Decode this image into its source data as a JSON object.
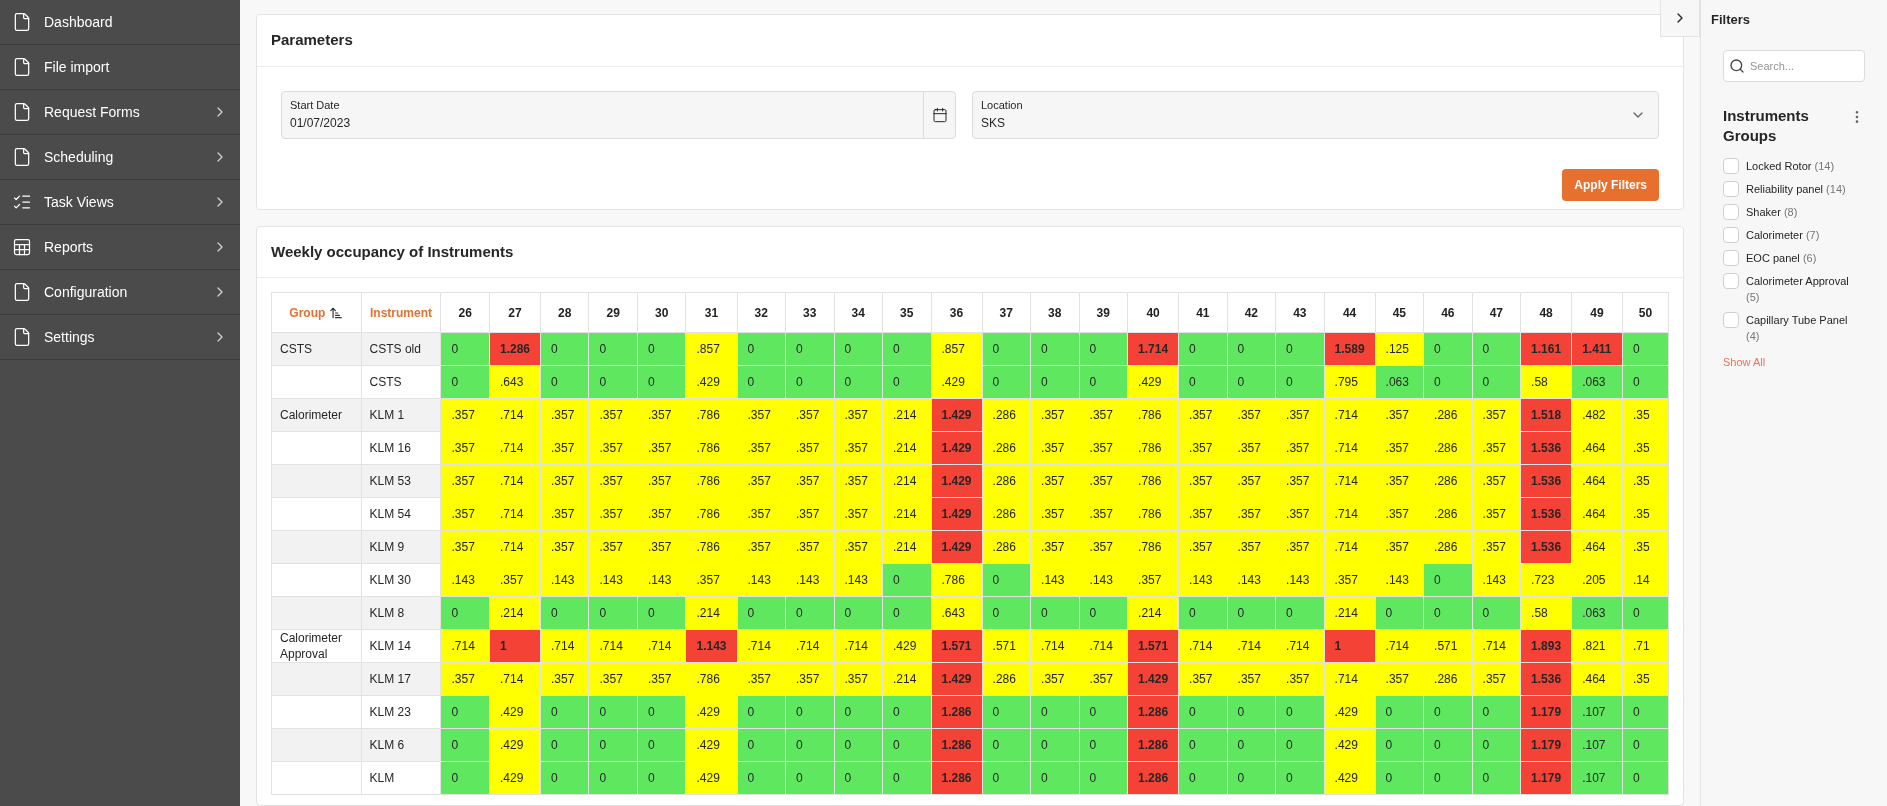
{
  "sidebar": {
    "items": [
      {
        "label": "Dashboard",
        "expandable": false
      },
      {
        "label": "File import",
        "expandable": false
      },
      {
        "label": "Request Forms",
        "expandable": true
      },
      {
        "label": "Scheduling",
        "expandable": true
      },
      {
        "label": "Task Views",
        "expandable": true
      },
      {
        "label": "Reports",
        "expandable": true
      },
      {
        "label": "Configuration",
        "expandable": true
      },
      {
        "label": "Settings",
        "expandable": true
      }
    ]
  },
  "parameters": {
    "title": "Parameters",
    "start_date": {
      "label": "Start Date",
      "value": "01/07/2023"
    },
    "location": {
      "label": "Location",
      "value": "SKS"
    },
    "apply_button": "Apply Filters"
  },
  "occupancy": {
    "title": "Weekly occupancy of Instruments",
    "columns": {
      "group": "Group",
      "instrument": "Instrument",
      "weeks": [
        "26",
        "27",
        "28",
        "29",
        "30",
        "31",
        "32",
        "33",
        "34",
        "35",
        "36",
        "37",
        "38",
        "39",
        "40",
        "41",
        "42",
        "43",
        "44",
        "45",
        "46",
        "47",
        "48",
        "49",
        "50"
      ]
    },
    "rows": [
      {
        "group": "CSTS",
        "instrument": "CSTS old",
        "cells": [
          {
            "value": "0",
            "kind": "low"
          },
          {
            "value": "1.286",
            "kind": "high"
          },
          {
            "value": "0",
            "kind": "low"
          },
          {
            "value": "0",
            "kind": "low"
          },
          {
            "value": "0",
            "kind": "low"
          },
          {
            "value": ".857",
            "kind": "mid"
          },
          {
            "value": "0",
            "kind": "low"
          },
          {
            "value": "0",
            "kind": "low"
          },
          {
            "value": "0",
            "kind": "low"
          },
          {
            "value": "0",
            "kind": "low"
          },
          {
            "value": ".857",
            "kind": "mid"
          },
          {
            "value": "0",
            "kind": "low"
          },
          {
            "value": "0",
            "kind": "low"
          },
          {
            "value": "0",
            "kind": "low"
          },
          {
            "value": "1.714",
            "kind": "high"
          },
          {
            "value": "0",
            "kind": "low"
          },
          {
            "value": "0",
            "kind": "low"
          },
          {
            "value": "0",
            "kind": "low"
          },
          {
            "value": "1.589",
            "kind": "high"
          },
          {
            "value": ".125",
            "kind": "mid"
          },
          {
            "value": "0",
            "kind": "low"
          },
          {
            "value": "0",
            "kind": "low"
          },
          {
            "value": "1.161",
            "kind": "high"
          },
          {
            "value": "1.411",
            "kind": "high"
          },
          {
            "value": "0",
            "kind": "low"
          }
        ]
      },
      {
        "group": "",
        "instrument": "CSTS",
        "cells": [
          {
            "value": "0",
            "kind": "low"
          },
          {
            "value": ".643",
            "kind": "mid"
          },
          {
            "value": "0",
            "kind": "low"
          },
          {
            "value": "0",
            "kind": "low"
          },
          {
            "value": "0",
            "kind": "low"
          },
          {
            "value": ".429",
            "kind": "mid"
          },
          {
            "value": "0",
            "kind": "low"
          },
          {
            "value": "0",
            "kind": "low"
          },
          {
            "value": "0",
            "kind": "low"
          },
          {
            "value": "0",
            "kind": "low"
          },
          {
            "value": ".429",
            "kind": "mid"
          },
          {
            "value": "0",
            "kind": "low"
          },
          {
            "value": "0",
            "kind": "low"
          },
          {
            "value": "0",
            "kind": "low"
          },
          {
            "value": ".429",
            "kind": "mid"
          },
          {
            "value": "0",
            "kind": "low"
          },
          {
            "value": "0",
            "kind": "low"
          },
          {
            "value": "0",
            "kind": "low"
          },
          {
            "value": ".795",
            "kind": "mid"
          },
          {
            "value": ".063",
            "kind": "low"
          },
          {
            "value": "0",
            "kind": "low"
          },
          {
            "value": "0",
            "kind": "low"
          },
          {
            "value": ".58",
            "kind": "mid"
          },
          {
            "value": ".063",
            "kind": "low"
          },
          {
            "value": "0",
            "kind": "low"
          }
        ]
      },
      {
        "group": "Calorimeter",
        "instrument": "KLM 1",
        "cells": [
          {
            "value": ".357",
            "kind": "mid"
          },
          {
            "value": ".714",
            "kind": "mid"
          },
          {
            "value": ".357",
            "kind": "mid"
          },
          {
            "value": ".357",
            "kind": "mid"
          },
          {
            "value": ".357",
            "kind": "mid"
          },
          {
            "value": ".786",
            "kind": "mid"
          },
          {
            "value": ".357",
            "kind": "mid"
          },
          {
            "value": ".357",
            "kind": "mid"
          },
          {
            "value": ".357",
            "kind": "mid"
          },
          {
            "value": ".214",
            "kind": "mid"
          },
          {
            "value": "1.429",
            "kind": "high"
          },
          {
            "value": ".286",
            "kind": "mid"
          },
          {
            "value": ".357",
            "kind": "mid"
          },
          {
            "value": ".357",
            "kind": "mid"
          },
          {
            "value": ".786",
            "kind": "mid"
          },
          {
            "value": ".357",
            "kind": "mid"
          },
          {
            "value": ".357",
            "kind": "mid"
          },
          {
            "value": ".357",
            "kind": "mid"
          },
          {
            "value": ".714",
            "kind": "mid"
          },
          {
            "value": ".357",
            "kind": "mid"
          },
          {
            "value": ".286",
            "kind": "mid"
          },
          {
            "value": ".357",
            "kind": "mid"
          },
          {
            "value": "1.518",
            "kind": "high"
          },
          {
            "value": ".482",
            "kind": "mid"
          },
          {
            "value": ".35",
            "kind": "mid"
          }
        ]
      },
      {
        "group": "",
        "instrument": "KLM 16",
        "cells": [
          {
            "value": ".357",
            "kind": "mid"
          },
          {
            "value": ".714",
            "kind": "mid"
          },
          {
            "value": ".357",
            "kind": "mid"
          },
          {
            "value": ".357",
            "kind": "mid"
          },
          {
            "value": ".357",
            "kind": "mid"
          },
          {
            "value": ".786",
            "kind": "mid"
          },
          {
            "value": ".357",
            "kind": "mid"
          },
          {
            "value": ".357",
            "kind": "mid"
          },
          {
            "value": ".357",
            "kind": "mid"
          },
          {
            "value": ".214",
            "kind": "mid"
          },
          {
            "value": "1.429",
            "kind": "high"
          },
          {
            "value": ".286",
            "kind": "mid"
          },
          {
            "value": ".357",
            "kind": "mid"
          },
          {
            "value": ".357",
            "kind": "mid"
          },
          {
            "value": ".786",
            "kind": "mid"
          },
          {
            "value": ".357",
            "kind": "mid"
          },
          {
            "value": ".357",
            "kind": "mid"
          },
          {
            "value": ".357",
            "kind": "mid"
          },
          {
            "value": ".714",
            "kind": "mid"
          },
          {
            "value": ".357",
            "kind": "mid"
          },
          {
            "value": ".286",
            "kind": "mid"
          },
          {
            "value": ".357",
            "kind": "mid"
          },
          {
            "value": "1.536",
            "kind": "high"
          },
          {
            "value": ".464",
            "kind": "mid"
          },
          {
            "value": ".35",
            "kind": "mid"
          }
        ]
      },
      {
        "group": "",
        "instrument": "KLM 53",
        "cells": [
          {
            "value": ".357",
            "kind": "mid"
          },
          {
            "value": ".714",
            "kind": "mid"
          },
          {
            "value": ".357",
            "kind": "mid"
          },
          {
            "value": ".357",
            "kind": "mid"
          },
          {
            "value": ".357",
            "kind": "mid"
          },
          {
            "value": ".786",
            "kind": "mid"
          },
          {
            "value": ".357",
            "kind": "mid"
          },
          {
            "value": ".357",
            "kind": "mid"
          },
          {
            "value": ".357",
            "kind": "mid"
          },
          {
            "value": ".214",
            "kind": "mid"
          },
          {
            "value": "1.429",
            "kind": "high"
          },
          {
            "value": ".286",
            "kind": "mid"
          },
          {
            "value": ".357",
            "kind": "mid"
          },
          {
            "value": ".357",
            "kind": "mid"
          },
          {
            "value": ".786",
            "kind": "mid"
          },
          {
            "value": ".357",
            "kind": "mid"
          },
          {
            "value": ".357",
            "kind": "mid"
          },
          {
            "value": ".357",
            "kind": "mid"
          },
          {
            "value": ".714",
            "kind": "mid"
          },
          {
            "value": ".357",
            "kind": "mid"
          },
          {
            "value": ".286",
            "kind": "mid"
          },
          {
            "value": ".357",
            "kind": "mid"
          },
          {
            "value": "1.536",
            "kind": "high"
          },
          {
            "value": ".464",
            "kind": "mid"
          },
          {
            "value": ".35",
            "kind": "mid"
          }
        ]
      },
      {
        "group": "",
        "instrument": "KLM 54",
        "cells": [
          {
            "value": ".357",
            "kind": "mid"
          },
          {
            "value": ".714",
            "kind": "mid"
          },
          {
            "value": ".357",
            "kind": "mid"
          },
          {
            "value": ".357",
            "kind": "mid"
          },
          {
            "value": ".357",
            "kind": "mid"
          },
          {
            "value": ".786",
            "kind": "mid"
          },
          {
            "value": ".357",
            "kind": "mid"
          },
          {
            "value": ".357",
            "kind": "mid"
          },
          {
            "value": ".357",
            "kind": "mid"
          },
          {
            "value": ".214",
            "kind": "mid"
          },
          {
            "value": "1.429",
            "kind": "high"
          },
          {
            "value": ".286",
            "kind": "mid"
          },
          {
            "value": ".357",
            "kind": "mid"
          },
          {
            "value": ".357",
            "kind": "mid"
          },
          {
            "value": ".786",
            "kind": "mid"
          },
          {
            "value": ".357",
            "kind": "mid"
          },
          {
            "value": ".357",
            "kind": "mid"
          },
          {
            "value": ".357",
            "kind": "mid"
          },
          {
            "value": ".714",
            "kind": "mid"
          },
          {
            "value": ".357",
            "kind": "mid"
          },
          {
            "value": ".286",
            "kind": "mid"
          },
          {
            "value": ".357",
            "kind": "mid"
          },
          {
            "value": "1.536",
            "kind": "high"
          },
          {
            "value": ".464",
            "kind": "mid"
          },
          {
            "value": ".35",
            "kind": "mid"
          }
        ]
      },
      {
        "group": "",
        "instrument": "KLM 9",
        "cells": [
          {
            "value": ".357",
            "kind": "mid"
          },
          {
            "value": ".714",
            "kind": "mid"
          },
          {
            "value": ".357",
            "kind": "mid"
          },
          {
            "value": ".357",
            "kind": "mid"
          },
          {
            "value": ".357",
            "kind": "mid"
          },
          {
            "value": ".786",
            "kind": "mid"
          },
          {
            "value": ".357",
            "kind": "mid"
          },
          {
            "value": ".357",
            "kind": "mid"
          },
          {
            "value": ".357",
            "kind": "mid"
          },
          {
            "value": ".214",
            "kind": "mid"
          },
          {
            "value": "1.429",
            "kind": "high"
          },
          {
            "value": ".286",
            "kind": "mid"
          },
          {
            "value": ".357",
            "kind": "mid"
          },
          {
            "value": ".357",
            "kind": "mid"
          },
          {
            "value": ".786",
            "kind": "mid"
          },
          {
            "value": ".357",
            "kind": "mid"
          },
          {
            "value": ".357",
            "kind": "mid"
          },
          {
            "value": ".357",
            "kind": "mid"
          },
          {
            "value": ".714",
            "kind": "mid"
          },
          {
            "value": ".357",
            "kind": "mid"
          },
          {
            "value": ".286",
            "kind": "mid"
          },
          {
            "value": ".357",
            "kind": "mid"
          },
          {
            "value": "1.536",
            "kind": "high"
          },
          {
            "value": ".464",
            "kind": "mid"
          },
          {
            "value": ".35",
            "kind": "mid"
          }
        ]
      },
      {
        "group": "",
        "instrument": "KLM 30",
        "cells": [
          {
            "value": ".143",
            "kind": "mid"
          },
          {
            "value": ".357",
            "kind": "mid"
          },
          {
            "value": ".143",
            "kind": "mid"
          },
          {
            "value": ".143",
            "kind": "mid"
          },
          {
            "value": ".143",
            "kind": "mid"
          },
          {
            "value": ".357",
            "kind": "mid"
          },
          {
            "value": ".143",
            "kind": "mid"
          },
          {
            "value": ".143",
            "kind": "mid"
          },
          {
            "value": ".143",
            "kind": "mid"
          },
          {
            "value": "0",
            "kind": "low"
          },
          {
            "value": ".786",
            "kind": "mid"
          },
          {
            "value": "0",
            "kind": "low"
          },
          {
            "value": ".143",
            "kind": "mid"
          },
          {
            "value": ".143",
            "kind": "mid"
          },
          {
            "value": ".357",
            "kind": "mid"
          },
          {
            "value": ".143",
            "kind": "mid"
          },
          {
            "value": ".143",
            "kind": "mid"
          },
          {
            "value": ".143",
            "kind": "mid"
          },
          {
            "value": ".357",
            "kind": "mid"
          },
          {
            "value": ".143",
            "kind": "mid"
          },
          {
            "value": "0",
            "kind": "low"
          },
          {
            "value": ".143",
            "kind": "mid"
          },
          {
            "value": ".723",
            "kind": "mid"
          },
          {
            "value": ".205",
            "kind": "mid"
          },
          {
            "value": ".14",
            "kind": "mid"
          }
        ]
      },
      {
        "group": "",
        "instrument": "KLM 8",
        "cells": [
          {
            "value": "0",
            "kind": "low"
          },
          {
            "value": ".214",
            "kind": "mid"
          },
          {
            "value": "0",
            "kind": "low"
          },
          {
            "value": "0",
            "kind": "low"
          },
          {
            "value": "0",
            "kind": "low"
          },
          {
            "value": ".214",
            "kind": "mid"
          },
          {
            "value": "0",
            "kind": "low"
          },
          {
            "value": "0",
            "kind": "low"
          },
          {
            "value": "0",
            "kind": "low"
          },
          {
            "value": "0",
            "kind": "low"
          },
          {
            "value": ".643",
            "kind": "mid"
          },
          {
            "value": "0",
            "kind": "low"
          },
          {
            "value": "0",
            "kind": "low"
          },
          {
            "value": "0",
            "kind": "low"
          },
          {
            "value": ".214",
            "kind": "mid"
          },
          {
            "value": "0",
            "kind": "low"
          },
          {
            "value": "0",
            "kind": "low"
          },
          {
            "value": "0",
            "kind": "low"
          },
          {
            "value": ".214",
            "kind": "mid"
          },
          {
            "value": "0",
            "kind": "low"
          },
          {
            "value": "0",
            "kind": "low"
          },
          {
            "value": "0",
            "kind": "low"
          },
          {
            "value": ".58",
            "kind": "mid"
          },
          {
            "value": ".063",
            "kind": "low"
          },
          {
            "value": "0",
            "kind": "low"
          }
        ]
      },
      {
        "group": "Calorimeter Approval",
        "instrument": "KLM 14",
        "cells": [
          {
            "value": ".714",
            "kind": "mid"
          },
          {
            "value": "1",
            "kind": "high"
          },
          {
            "value": ".714",
            "kind": "mid"
          },
          {
            "value": ".714",
            "kind": "mid"
          },
          {
            "value": ".714",
            "kind": "mid"
          },
          {
            "value": "1.143",
            "kind": "high"
          },
          {
            "value": ".714",
            "kind": "mid"
          },
          {
            "value": ".714",
            "kind": "mid"
          },
          {
            "value": ".714",
            "kind": "mid"
          },
          {
            "value": ".429",
            "kind": "mid"
          },
          {
            "value": "1.571",
            "kind": "high"
          },
          {
            "value": ".571",
            "kind": "mid"
          },
          {
            "value": ".714",
            "kind": "mid"
          },
          {
            "value": ".714",
            "kind": "mid"
          },
          {
            "value": "1.571",
            "kind": "high"
          },
          {
            "value": ".714",
            "kind": "mid"
          },
          {
            "value": ".714",
            "kind": "mid"
          },
          {
            "value": ".714",
            "kind": "mid"
          },
          {
            "value": "1",
            "kind": "high"
          },
          {
            "value": ".714",
            "kind": "mid"
          },
          {
            "value": ".571",
            "kind": "mid"
          },
          {
            "value": ".714",
            "kind": "mid"
          },
          {
            "value": "1.893",
            "kind": "high"
          },
          {
            "value": ".821",
            "kind": "mid"
          },
          {
            "value": ".71",
            "kind": "mid"
          }
        ]
      },
      {
        "group": "",
        "instrument": "KLM 17",
        "cells": [
          {
            "value": ".357",
            "kind": "mid"
          },
          {
            "value": ".714",
            "kind": "mid"
          },
          {
            "value": ".357",
            "kind": "mid"
          },
          {
            "value": ".357",
            "kind": "mid"
          },
          {
            "value": ".357",
            "kind": "mid"
          },
          {
            "value": ".786",
            "kind": "mid"
          },
          {
            "value": ".357",
            "kind": "mid"
          },
          {
            "value": ".357",
            "kind": "mid"
          },
          {
            "value": ".357",
            "kind": "mid"
          },
          {
            "value": ".214",
            "kind": "mid"
          },
          {
            "value": "1.429",
            "kind": "high"
          },
          {
            "value": ".286",
            "kind": "mid"
          },
          {
            "value": ".357",
            "kind": "mid"
          },
          {
            "value": ".357",
            "kind": "mid"
          },
          {
            "value": "1.429",
            "kind": "high"
          },
          {
            "value": ".357",
            "kind": "mid"
          },
          {
            "value": ".357",
            "kind": "mid"
          },
          {
            "value": ".357",
            "kind": "mid"
          },
          {
            "value": ".714",
            "kind": "mid"
          },
          {
            "value": ".357",
            "kind": "mid"
          },
          {
            "value": ".286",
            "kind": "mid"
          },
          {
            "value": ".357",
            "kind": "mid"
          },
          {
            "value": "1.536",
            "kind": "high"
          },
          {
            "value": ".464",
            "kind": "mid"
          },
          {
            "value": ".35",
            "kind": "mid"
          }
        ]
      },
      {
        "group": "",
        "instrument": "KLM 23",
        "cells": [
          {
            "value": "0",
            "kind": "low"
          },
          {
            "value": ".429",
            "kind": "mid"
          },
          {
            "value": "0",
            "kind": "low"
          },
          {
            "value": "0",
            "kind": "low"
          },
          {
            "value": "0",
            "kind": "low"
          },
          {
            "value": ".429",
            "kind": "mid"
          },
          {
            "value": "0",
            "kind": "low"
          },
          {
            "value": "0",
            "kind": "low"
          },
          {
            "value": "0",
            "kind": "low"
          },
          {
            "value": "0",
            "kind": "low"
          },
          {
            "value": "1.286",
            "kind": "high"
          },
          {
            "value": "0",
            "kind": "low"
          },
          {
            "value": "0",
            "kind": "low"
          },
          {
            "value": "0",
            "kind": "low"
          },
          {
            "value": "1.286",
            "kind": "high"
          },
          {
            "value": "0",
            "kind": "low"
          },
          {
            "value": "0",
            "kind": "low"
          },
          {
            "value": "0",
            "kind": "low"
          },
          {
            "value": ".429",
            "kind": "mid"
          },
          {
            "value": "0",
            "kind": "low"
          },
          {
            "value": "0",
            "kind": "low"
          },
          {
            "value": "0",
            "kind": "low"
          },
          {
            "value": "1.179",
            "kind": "high"
          },
          {
            "value": ".107",
            "kind": "low"
          },
          {
            "value": "0",
            "kind": "low"
          }
        ]
      },
      {
        "group": "",
        "instrument": "KLM 6",
        "cells": [
          {
            "value": "0",
            "kind": "low"
          },
          {
            "value": ".429",
            "kind": "mid"
          },
          {
            "value": "0",
            "kind": "low"
          },
          {
            "value": "0",
            "kind": "low"
          },
          {
            "value": "0",
            "kind": "low"
          },
          {
            "value": ".429",
            "kind": "mid"
          },
          {
            "value": "0",
            "kind": "low"
          },
          {
            "value": "0",
            "kind": "low"
          },
          {
            "value": "0",
            "kind": "low"
          },
          {
            "value": "0",
            "kind": "low"
          },
          {
            "value": "1.286",
            "kind": "high"
          },
          {
            "value": "0",
            "kind": "low"
          },
          {
            "value": "0",
            "kind": "low"
          },
          {
            "value": "0",
            "kind": "low"
          },
          {
            "value": "1.286",
            "kind": "high"
          },
          {
            "value": "0",
            "kind": "low"
          },
          {
            "value": "0",
            "kind": "low"
          },
          {
            "value": "0",
            "kind": "low"
          },
          {
            "value": ".429",
            "kind": "mid"
          },
          {
            "value": "0",
            "kind": "low"
          },
          {
            "value": "0",
            "kind": "low"
          },
          {
            "value": "0",
            "kind": "low"
          },
          {
            "value": "1.179",
            "kind": "high"
          },
          {
            "value": ".107",
            "kind": "low"
          },
          {
            "value": "0",
            "kind": "low"
          }
        ]
      },
      {
        "group": "",
        "instrument": "KLM",
        "cells": [
          {
            "value": "0",
            "kind": "low"
          },
          {
            "value": ".429",
            "kind": "mid"
          },
          {
            "value": "0",
            "kind": "low"
          },
          {
            "value": "0",
            "kind": "low"
          },
          {
            "value": "0",
            "kind": "low"
          },
          {
            "value": ".429",
            "kind": "mid"
          },
          {
            "value": "0",
            "kind": "low"
          },
          {
            "value": "0",
            "kind": "low"
          },
          {
            "value": "0",
            "kind": "low"
          },
          {
            "value": "0",
            "kind": "low"
          },
          {
            "value": "1.286",
            "kind": "high"
          },
          {
            "value": "0",
            "kind": "low"
          },
          {
            "value": "0",
            "kind": "low"
          },
          {
            "value": "0",
            "kind": "low"
          },
          {
            "value": "1.286",
            "kind": "high"
          },
          {
            "value": "0",
            "kind": "low"
          },
          {
            "value": "0",
            "kind": "low"
          },
          {
            "value": "0",
            "kind": "low"
          },
          {
            "value": ".429",
            "kind": "mid"
          },
          {
            "value": "0",
            "kind": "low"
          },
          {
            "value": "0",
            "kind": "low"
          },
          {
            "value": "0",
            "kind": "low"
          },
          {
            "value": "1.179",
            "kind": "high"
          },
          {
            "value": ".107",
            "kind": "low"
          },
          {
            "value": "0",
            "kind": "low"
          }
        ]
      }
    ]
  },
  "filters": {
    "title": "Filters",
    "search_placeholder": "Search...",
    "group_title": "Instruments Groups",
    "options": [
      {
        "label": "Locked Rotor",
        "count": "(14)",
        "checked": false
      },
      {
        "label": "Reliability panel",
        "count": "(14)",
        "checked": false
      },
      {
        "label": "Shaker",
        "count": "(8)",
        "checked": false
      },
      {
        "label": "Calorimeter",
        "count": "(7)",
        "checked": false
      },
      {
        "label": "EOC panel",
        "count": "(6)",
        "checked": false
      },
      {
        "label": "Calorimeter Approval",
        "count": "(5)",
        "checked": false
      },
      {
        "label": "Capillary Tube Panel",
        "count": "(4)",
        "checked": false
      }
    ],
    "show_all": "Show All"
  }
}
